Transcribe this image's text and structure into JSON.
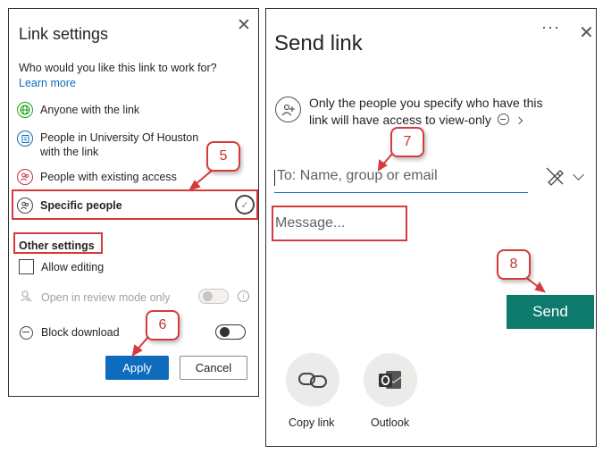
{
  "link_settings": {
    "title": "Link settings",
    "close_glyph": "✕",
    "question": "Who would you like this link to work for?",
    "learn_more": "Learn more",
    "options": [
      {
        "label_line1": "Anyone with the link",
        "label_line2": "",
        "icon": "globe-icon",
        "color": "#13a10e"
      },
      {
        "label_line1": "People in University Of Houston",
        "label_line2": "with the link",
        "icon": "building-icon",
        "color": "#0f6cbd"
      },
      {
        "label_line1": "People with existing access",
        "label_line2": "",
        "icon": "people-icon",
        "color": "#c4314b"
      },
      {
        "label_line1": "Specific people",
        "label_line2": "",
        "icon": "specific-people-icon",
        "color": "#444444",
        "selected": true
      }
    ],
    "check_glyph": "✓",
    "other_settings": "Other settings",
    "allow_editing": {
      "label": "Allow editing",
      "checked": false
    },
    "review_mode": {
      "label": "Open in review mode only",
      "enabled": false,
      "on": false,
      "info_glyph": "i"
    },
    "block_download": {
      "label": "Block download",
      "on": false
    },
    "apply_label": "Apply",
    "cancel_label": "Cancel"
  },
  "send_link": {
    "title": "Send link",
    "more_glyph": "···",
    "close_glyph": "✕",
    "info_text_line1": "Only the people you specify who have this",
    "info_text_line2": "link will have access to view-only",
    "to_placeholder": "To: Name, group or email",
    "message_placeholder": "Message...",
    "send_label": "Send",
    "copy_link_label": "Copy link",
    "outlook_label": "Outlook"
  },
  "annotations": {
    "step5": "5",
    "step6": "6",
    "step7": "7",
    "step8": "8",
    "color": "#d63a3a"
  }
}
